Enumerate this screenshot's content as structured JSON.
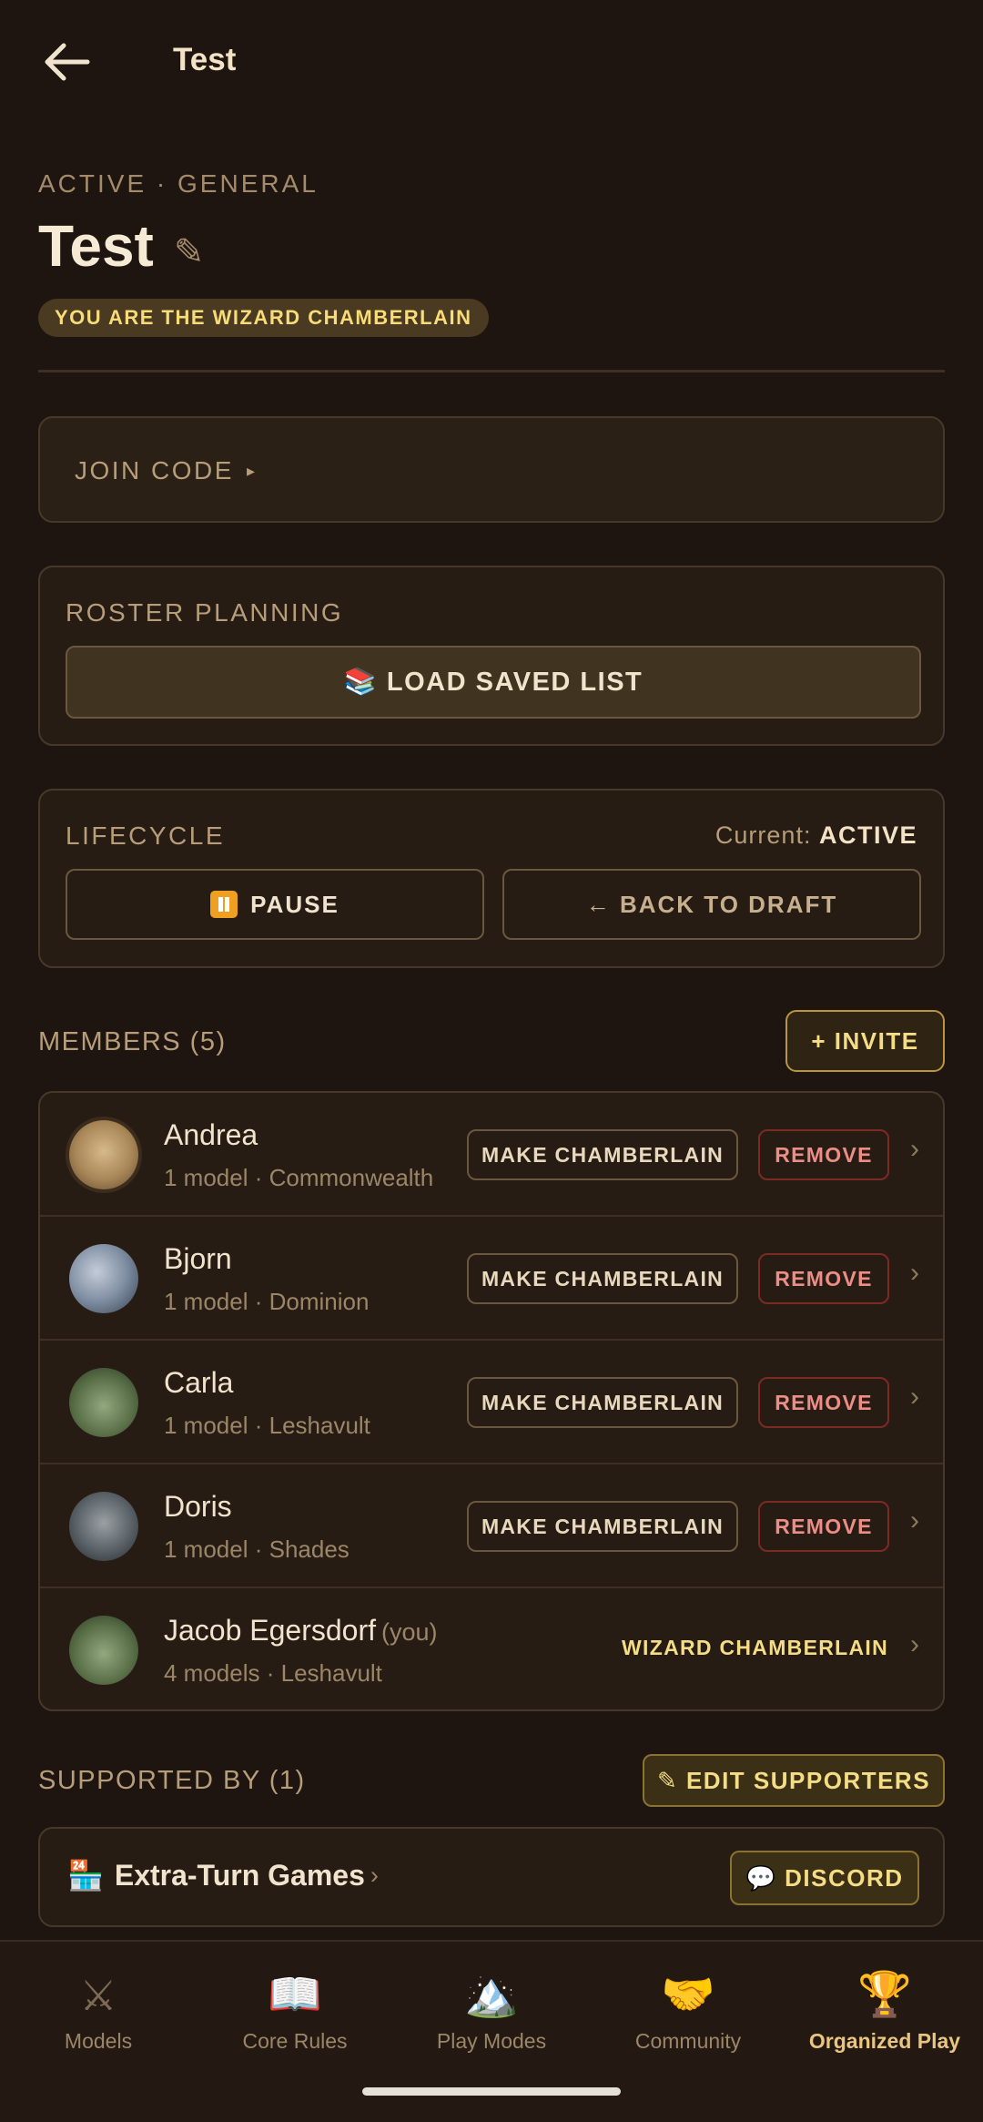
{
  "topbar": {
    "title": "Test",
    "back_icon": "arrow-left-icon"
  },
  "league": {
    "status_line": "ACTIVE · GENERAL",
    "title": "Test",
    "edit_icon": "✎",
    "role_pill": "YOU ARE THE WIZARD CHAMBERLAIN"
  },
  "join_code": {
    "label": "JOIN CODE",
    "arrow": "▸"
  },
  "roster": {
    "label": "ROSTER PLANNING",
    "load_button": "📚 LOAD SAVED LIST"
  },
  "lifecycle": {
    "label": "LIFECYCLE",
    "current_prefix": "Current:",
    "current_value": "ACTIVE",
    "pause_button": "PAUSE",
    "draft_button": "← BACK TO DRAFT"
  },
  "members": {
    "heading": "MEMBERS (5)",
    "invite_button": "+ INVITE",
    "make_label": "MAKE CHAMBERLAIN",
    "remove_label": "REMOVE",
    "list": [
      {
        "name": "Andrea",
        "sub": "1 model · Commonwealth"
      },
      {
        "name": "Bjorn",
        "sub": "1 model · Dominion"
      },
      {
        "name": "Carla",
        "sub": "1 model · Leshavult"
      },
      {
        "name": "Doris",
        "sub": "1 model · Shades"
      },
      {
        "name": "Jacob Egersdorf",
        "you": "(you)",
        "sub": "4 models · Leshavult",
        "role": "WIZARD CHAMBERLAIN"
      }
    ]
  },
  "supporters": {
    "heading": "SUPPORTED BY (1)",
    "edit_button": "✎ EDIT SUPPORTERS",
    "store_icon": "🏪",
    "store_name": "Extra-Turn Games",
    "chevron": "›",
    "discord_button": "💬 DISCORD"
  },
  "nav": [
    {
      "label": "Models",
      "icon": "⚔"
    },
    {
      "label": "Core Rules",
      "icon": "📖"
    },
    {
      "label": "Play Modes",
      "icon": "🏔️"
    },
    {
      "label": "Community",
      "icon": "🤝"
    },
    {
      "label": "Organized Play",
      "icon": "🏆",
      "active": true
    }
  ]
}
